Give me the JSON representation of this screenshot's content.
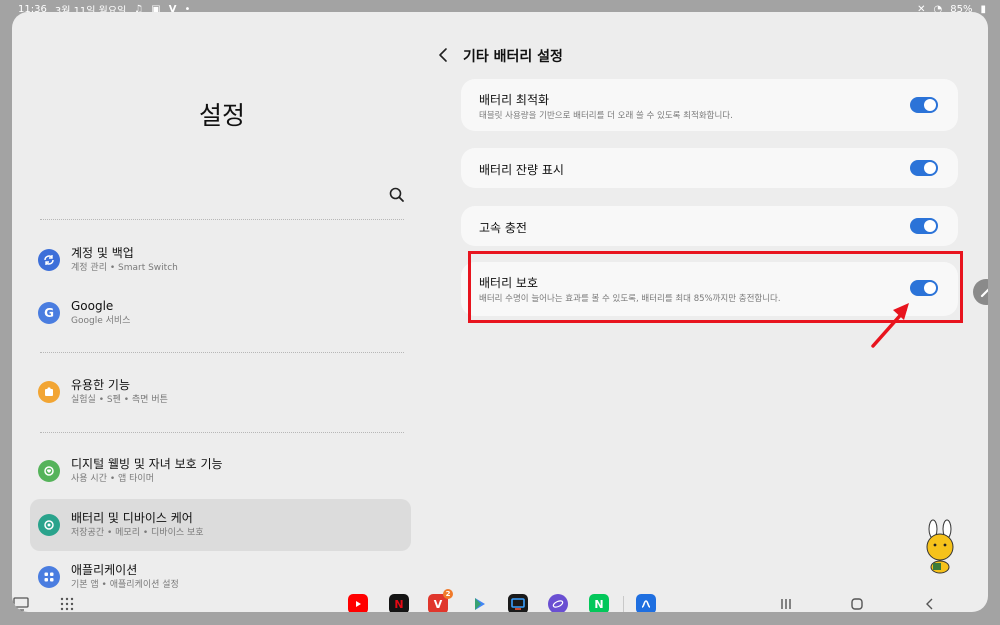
{
  "status_bar": {
    "time": "11:36",
    "date": "3월 11일 월요일",
    "battery": "85%"
  },
  "left_panel": {
    "title": "설정",
    "items": [
      {
        "title": "계정 및 백업",
        "subtitle": "계정 관리 • Smart Switch",
        "icon": "sync-icon",
        "color": "#3d6fd9"
      },
      {
        "title": "Google",
        "subtitle": "Google 서비스",
        "icon": "google-icon",
        "color": "#4a7de0"
      },
      {
        "title": "유용한 기능",
        "subtitle": "실험실 • S펜 • 측면 버튼",
        "icon": "puzzle-icon",
        "color": "#f2a533"
      },
      {
        "title": "디지털 웰빙 및 자녀 보호 기능",
        "subtitle": "사용 시간 • 앱 타이머",
        "icon": "wellbeing-icon",
        "color": "#55b35a"
      },
      {
        "title": "배터리 및 디바이스 케어",
        "subtitle": "저장공간 • 메모리 • 디바이스 보호",
        "icon": "device-care-icon",
        "color": "#2aa38c"
      },
      {
        "title": "애플리케이션",
        "subtitle": "기본 앱 • 애플리케이션 설정",
        "icon": "apps-icon",
        "color": "#4a7de0"
      }
    ]
  },
  "right_panel": {
    "title": "기타 배터리 설정",
    "settings": [
      {
        "title": "배터리 최적화",
        "subtitle": "태블릿 사용량을 기반으로 배터리를 더 오래 쓸 수 있도록 최적화합니다.",
        "enabled": true
      },
      {
        "title": "배터리 잔량 표시",
        "subtitle": "",
        "enabled": true
      },
      {
        "title": "고속 충전",
        "subtitle": "",
        "enabled": true
      },
      {
        "title": "배터리 보호",
        "subtitle": "배터리 수명이 늘어나는 효과를 볼 수 있도록, 배터리를 최대 85%까지만 충전합니다.",
        "enabled": true
      }
    ]
  },
  "dock": {
    "apps": [
      {
        "name": "youtube-app-icon",
        "color": "#ff0000"
      },
      {
        "name": "netflix-app-icon",
        "color": "#141414",
        "label": "N"
      },
      {
        "name": "vmark-app-icon",
        "color": "#e0362c",
        "badge": "2"
      },
      {
        "name": "play-store-app-icon",
        "color": "#e8e8e8"
      },
      {
        "name": "tv-app-icon",
        "color": "#1a1a1a"
      },
      {
        "name": "internet-app-icon",
        "color": "#6a4fd2"
      },
      {
        "name": "naver-app-icon",
        "color": "#03c75a",
        "label": "N"
      },
      {
        "name": "link-app-icon",
        "color": "#1f6fe0"
      }
    ]
  },
  "colors": {
    "accent": "#2b73d8",
    "highlight": "#e8141e",
    "panel_bg": "#ededed",
    "card_bg": "#f8f8f8"
  }
}
